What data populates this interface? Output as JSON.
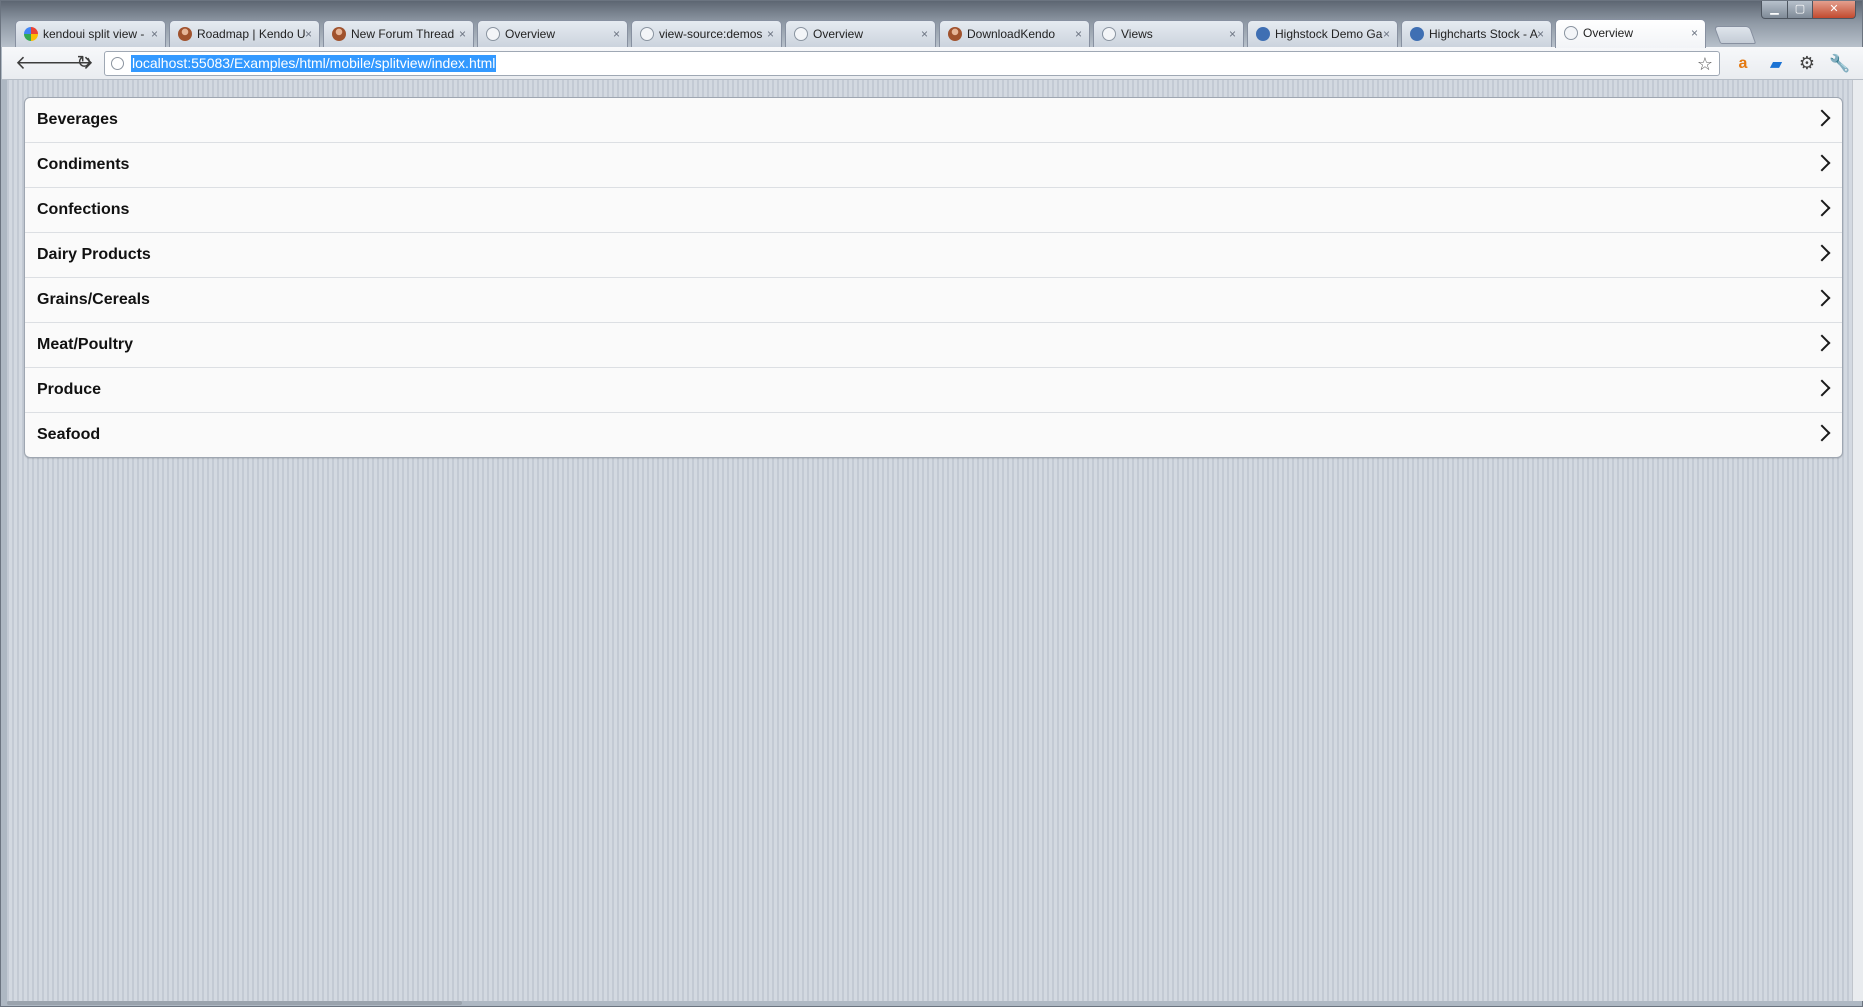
{
  "browser": {
    "tabs": [
      {
        "title": "kendoui split view -",
        "icon": "google-icon"
      },
      {
        "title": "Roadmap | Kendo U",
        "icon": "user-avatar-icon"
      },
      {
        "title": "New Forum Thread",
        "icon": "user-avatar-icon"
      },
      {
        "title": "Overview",
        "icon": "globe-icon"
      },
      {
        "title": "view-source:demos",
        "icon": "globe-icon"
      },
      {
        "title": "Overview",
        "icon": "globe-icon"
      },
      {
        "title": "DownloadKendo",
        "icon": "user-avatar-icon"
      },
      {
        "title": "Views",
        "icon": "globe-icon"
      },
      {
        "title": "Highstock Demo Ga",
        "icon": "wordpress-icon"
      },
      {
        "title": "Highcharts Stock - A",
        "icon": "wordpress-icon"
      },
      {
        "title": "Overview",
        "icon": "globe-icon",
        "active": true
      }
    ],
    "tab_close_glyph": "×",
    "address": "localhost:55083/Examples/html/mobile/splitview/index.html",
    "nav": {
      "back": "🡐",
      "forward": "🡒",
      "reload": "↻"
    },
    "window_controls": {
      "minimize": "▁",
      "maximize": "▢",
      "close": "✕"
    },
    "toolbar_icons": {
      "star": "☆",
      "amazon": "a",
      "sp": "▰",
      "gear": "⚙",
      "wrench": "🔧"
    }
  },
  "list": {
    "items": [
      {
        "label": "Beverages"
      },
      {
        "label": "Condiments"
      },
      {
        "label": "Confections"
      },
      {
        "label": "Dairy Products"
      },
      {
        "label": "Grains/Cereals"
      },
      {
        "label": "Meat/Poultry"
      },
      {
        "label": "Produce"
      },
      {
        "label": "Seafood"
      }
    ]
  },
  "colors": {
    "selection": "#3399ff",
    "list_background": "#fafafa",
    "page_background": "#c9d0d9"
  }
}
